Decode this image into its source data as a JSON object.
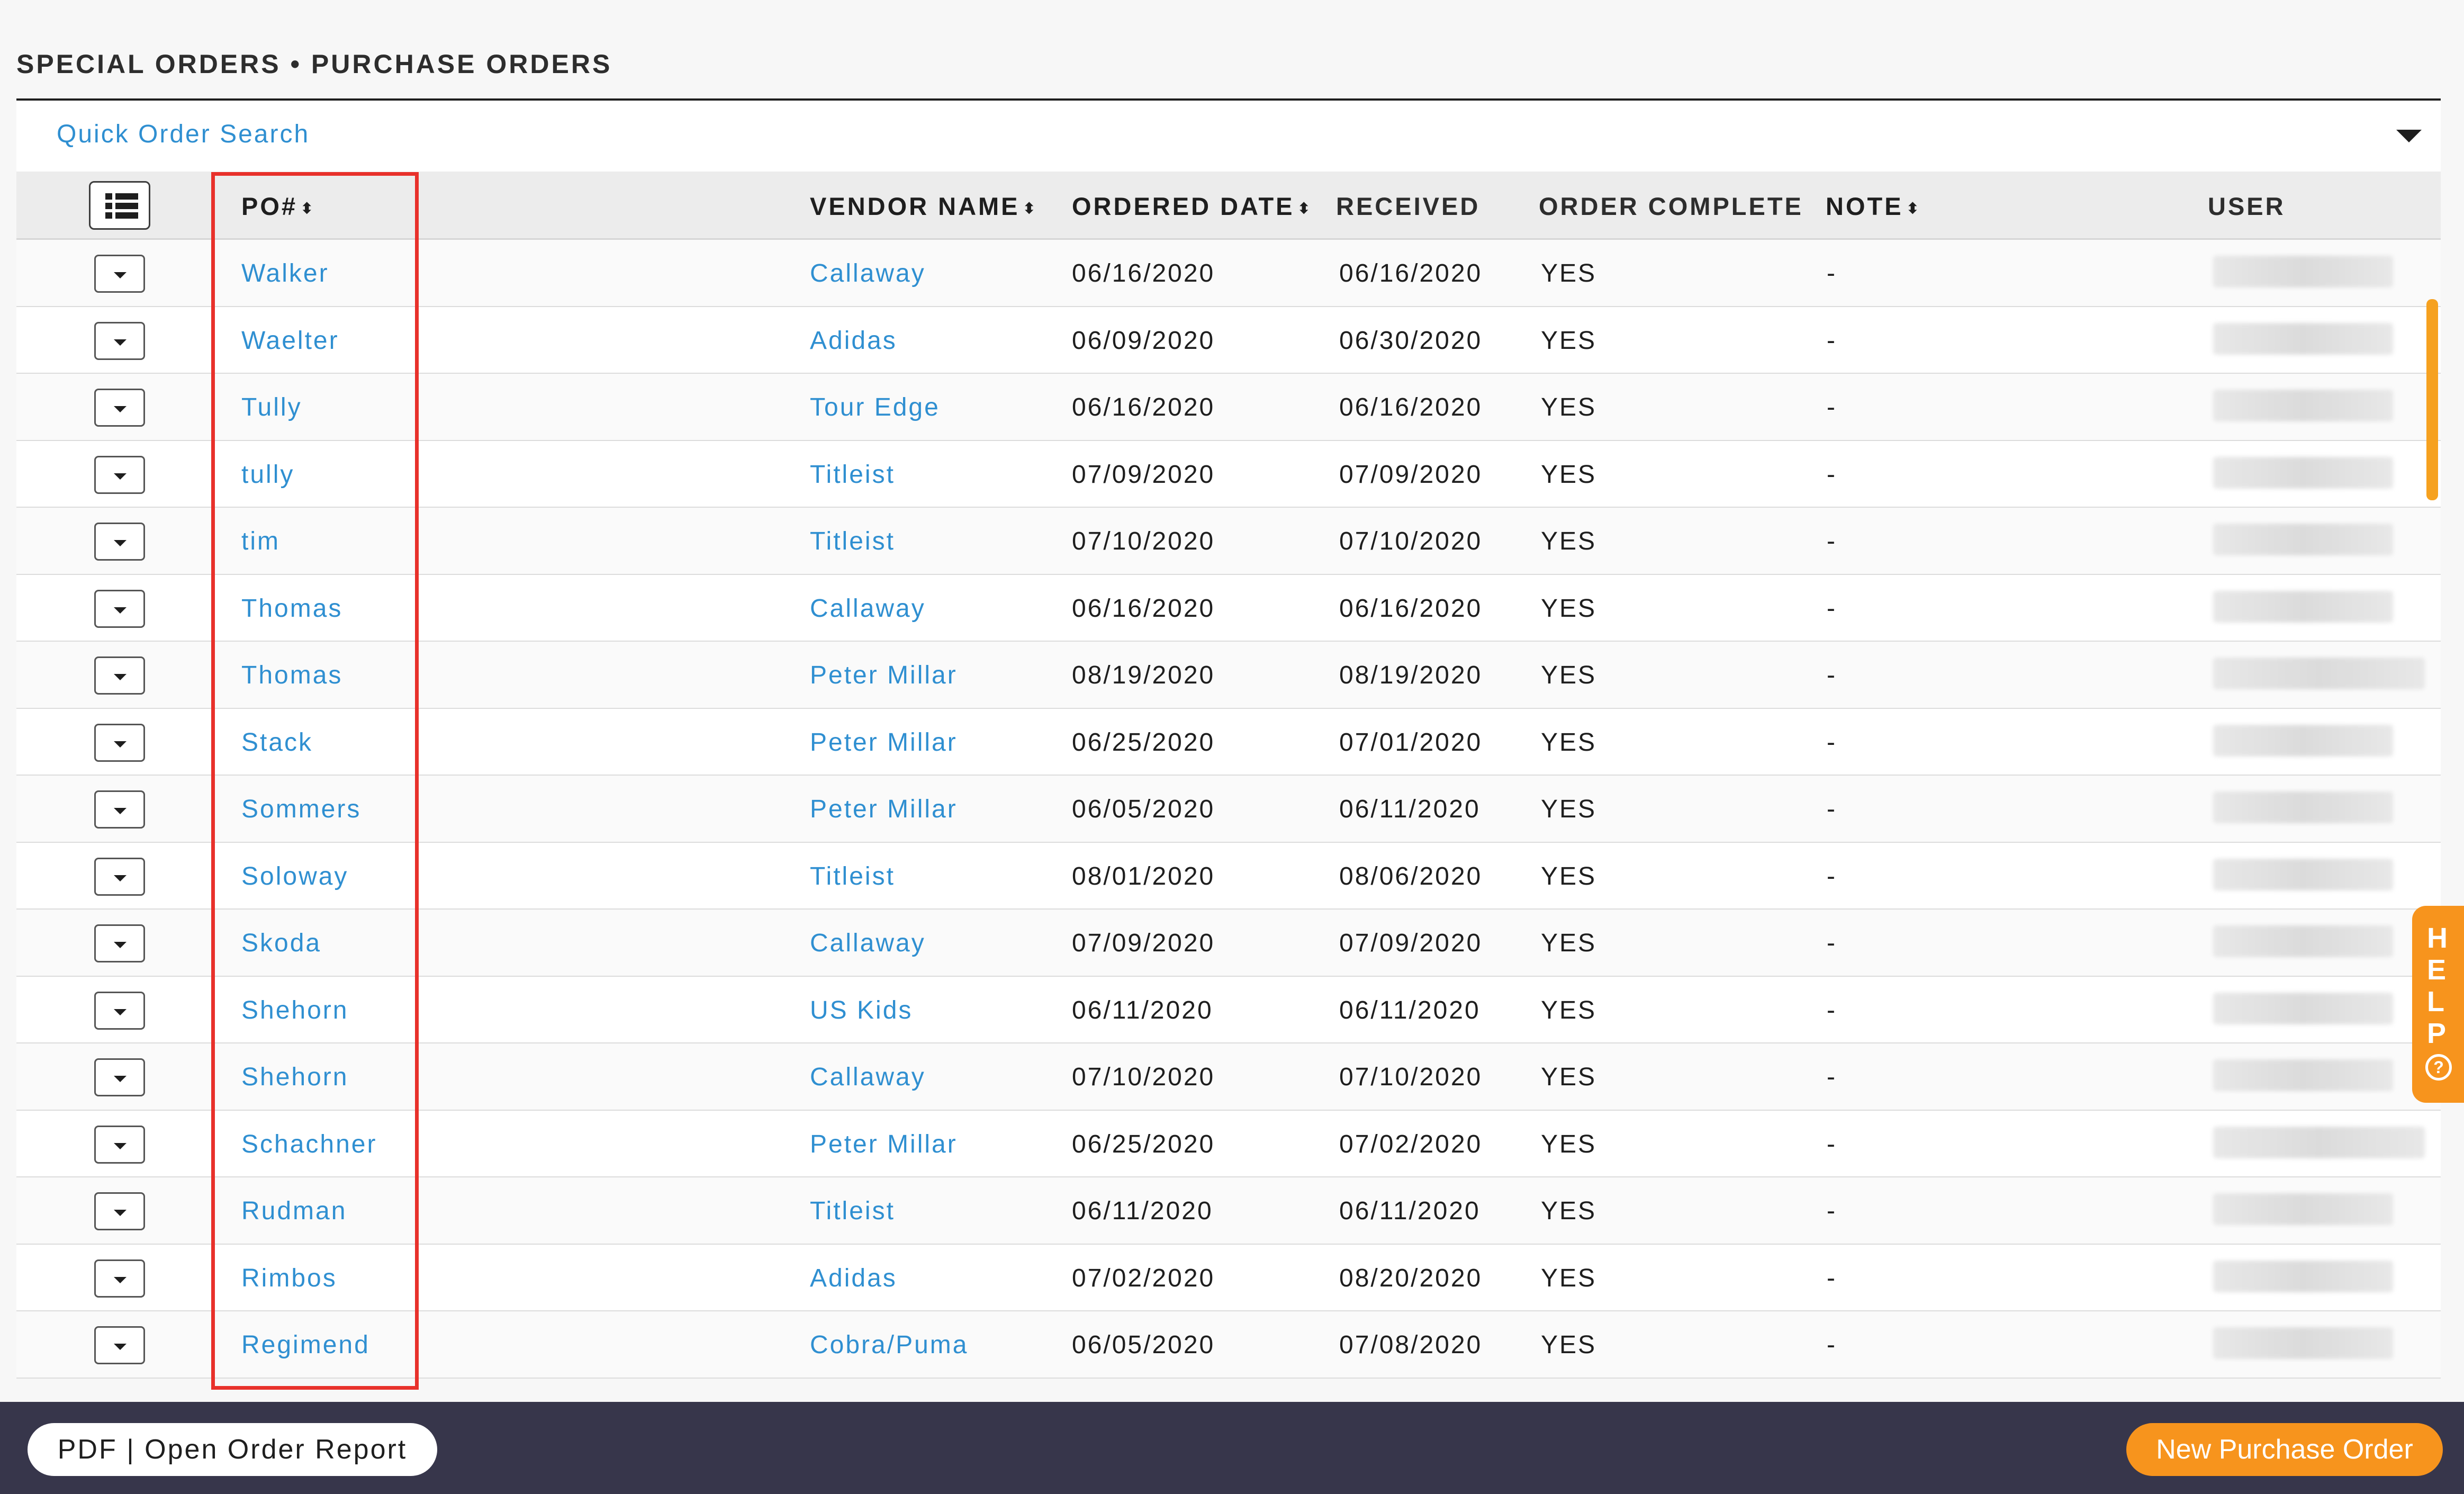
{
  "page": {
    "title": "SPECIAL ORDERS • PURCHASE ORDERS"
  },
  "search": {
    "label": "Quick Order Search"
  },
  "table": {
    "columns": {
      "po": "PO#",
      "vendor": "VENDOR NAME",
      "ordered": "ORDERED DATE",
      "received": "RECEIVED",
      "complete": "ORDER COMPLETE",
      "note": "NOTE",
      "user": "USER"
    },
    "rows": [
      {
        "po": "Walker",
        "vendor": "Callaway",
        "ordered": "06/16/2020",
        "received": "06/16/2020",
        "complete": "YES",
        "note": "-"
      },
      {
        "po": "Waelter",
        "vendor": "Adidas",
        "ordered": "06/09/2020",
        "received": "06/30/2020",
        "complete": "YES",
        "note": "-"
      },
      {
        "po": "Tully",
        "vendor": "Tour Edge",
        "ordered": "06/16/2020",
        "received": "06/16/2020",
        "complete": "YES",
        "note": "-"
      },
      {
        "po": "tully",
        "vendor": "Titleist",
        "ordered": "07/09/2020",
        "received": "07/09/2020",
        "complete": "YES",
        "note": "-"
      },
      {
        "po": "tim",
        "vendor": "Titleist",
        "ordered": "07/10/2020",
        "received": "07/10/2020",
        "complete": "YES",
        "note": "-"
      },
      {
        "po": "Thomas",
        "vendor": "Callaway",
        "ordered": "06/16/2020",
        "received": "06/16/2020",
        "complete": "YES",
        "note": "-"
      },
      {
        "po": "Thomas",
        "vendor": "Peter Millar",
        "ordered": "08/19/2020",
        "received": "08/19/2020",
        "complete": "YES",
        "note": "-"
      },
      {
        "po": "Stack",
        "vendor": "Peter Millar",
        "ordered": "06/25/2020",
        "received": "07/01/2020",
        "complete": "YES",
        "note": "-"
      },
      {
        "po": "Sommers",
        "vendor": "Peter Millar",
        "ordered": "06/05/2020",
        "received": "06/11/2020",
        "complete": "YES",
        "note": "-"
      },
      {
        "po": "Soloway",
        "vendor": "Titleist",
        "ordered": "08/01/2020",
        "received": "08/06/2020",
        "complete": "YES",
        "note": "-"
      },
      {
        "po": "Skoda",
        "vendor": "Callaway",
        "ordered": "07/09/2020",
        "received": "07/09/2020",
        "complete": "YES",
        "note": "-"
      },
      {
        "po": "Shehorn",
        "vendor": "US Kids",
        "ordered": "06/11/2020",
        "received": "06/11/2020",
        "complete": "YES",
        "note": "-"
      },
      {
        "po": "Shehorn",
        "vendor": "Callaway",
        "ordered": "07/10/2020",
        "received": "07/10/2020",
        "complete": "YES",
        "note": "-"
      },
      {
        "po": "Schachner",
        "vendor": "Peter Millar",
        "ordered": "06/25/2020",
        "received": "07/02/2020",
        "complete": "YES",
        "note": "-"
      },
      {
        "po": "Rudman",
        "vendor": "Titleist",
        "ordered": "06/11/2020",
        "received": "06/11/2020",
        "complete": "YES",
        "note": "-"
      },
      {
        "po": "Rimbos",
        "vendor": "Adidas",
        "ordered": "07/02/2020",
        "received": "08/20/2020",
        "complete": "YES",
        "note": "-"
      },
      {
        "po": "Regimend",
        "vendor": "Cobra/Puma",
        "ordered": "06/05/2020",
        "received": "07/08/2020",
        "complete": "YES",
        "note": "-"
      }
    ]
  },
  "help": {
    "letters": [
      "H",
      "E",
      "L",
      "P"
    ],
    "question": "?"
  },
  "footer": {
    "pdf_label": "PDF | Open Order Report",
    "new_label": "New Purchase Order"
  },
  "colors": {
    "link": "#2f8fd1",
    "accent": "#f7941d",
    "footer_bg": "#37364b",
    "highlight": "#e8312b"
  },
  "icons": {
    "list_view": "list-icon",
    "row_menu": "caret-down-icon",
    "search_toggle": "caret-down-icon"
  }
}
